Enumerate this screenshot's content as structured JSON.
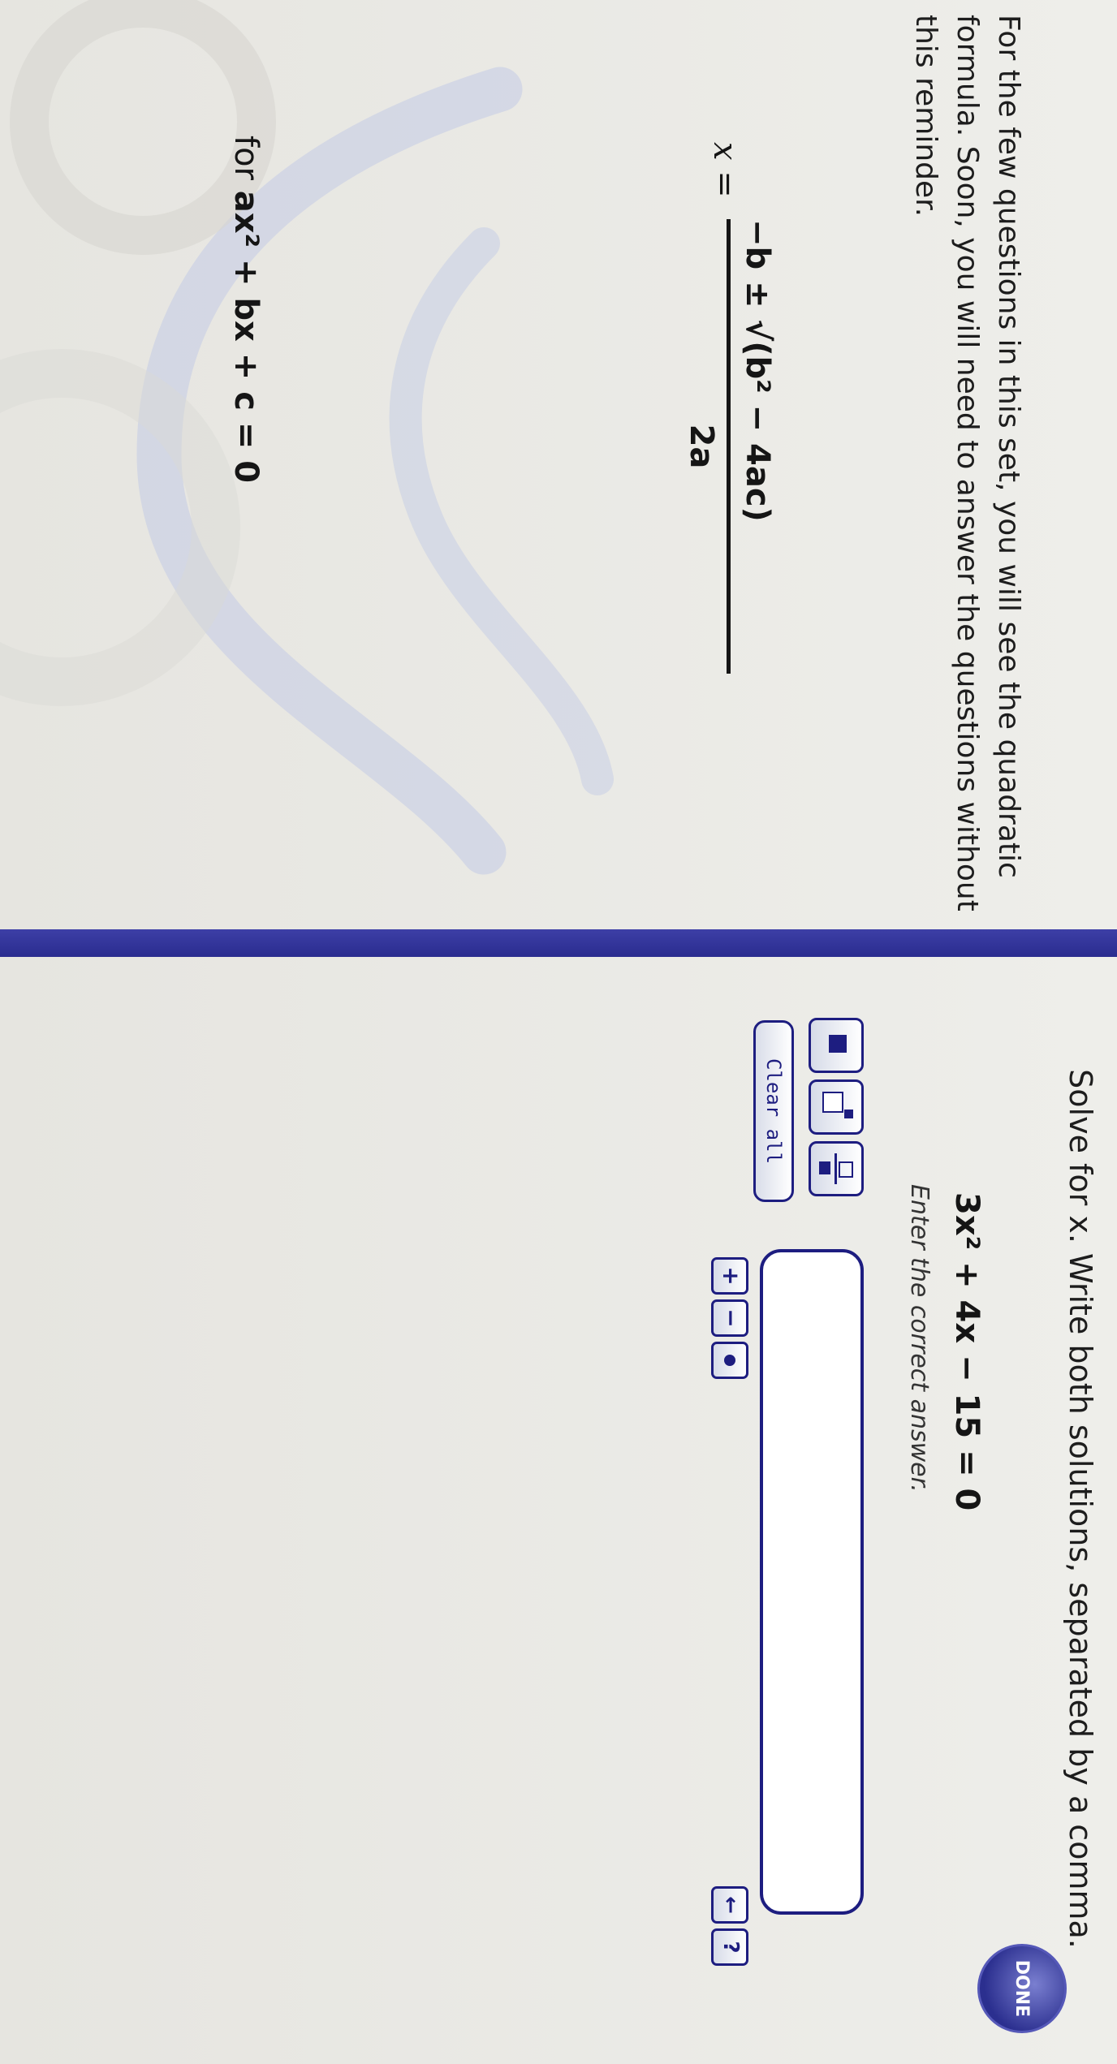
{
  "left_panel": {
    "intro": "For the few questions in this set, you will see the quadratic formula. Soon, you will need to answer the questions without this reminder.",
    "formula": {
      "lhs": "x =",
      "numerator": "−b ± √(b² − 4ac)",
      "denominator": "2a",
      "condition_prefix": "for",
      "condition_expr": "ax² + bx + c = 0"
    }
  },
  "right_panel": {
    "prompt": "Solve for x. Write both solutions, separated by a comma.",
    "equation": "3x² + 4x − 15 = 0",
    "instruction": "Enter the correct answer.",
    "answer_value": "",
    "clear_all_label": "Clear all",
    "op_buttons": [
      "+",
      "−"
    ],
    "back_label": "←",
    "help_label": "?",
    "done_label": "DONE"
  },
  "colors": {
    "accent": "#1d1d80",
    "divider": "#3d3fa6",
    "background": "#e9e8e3"
  }
}
